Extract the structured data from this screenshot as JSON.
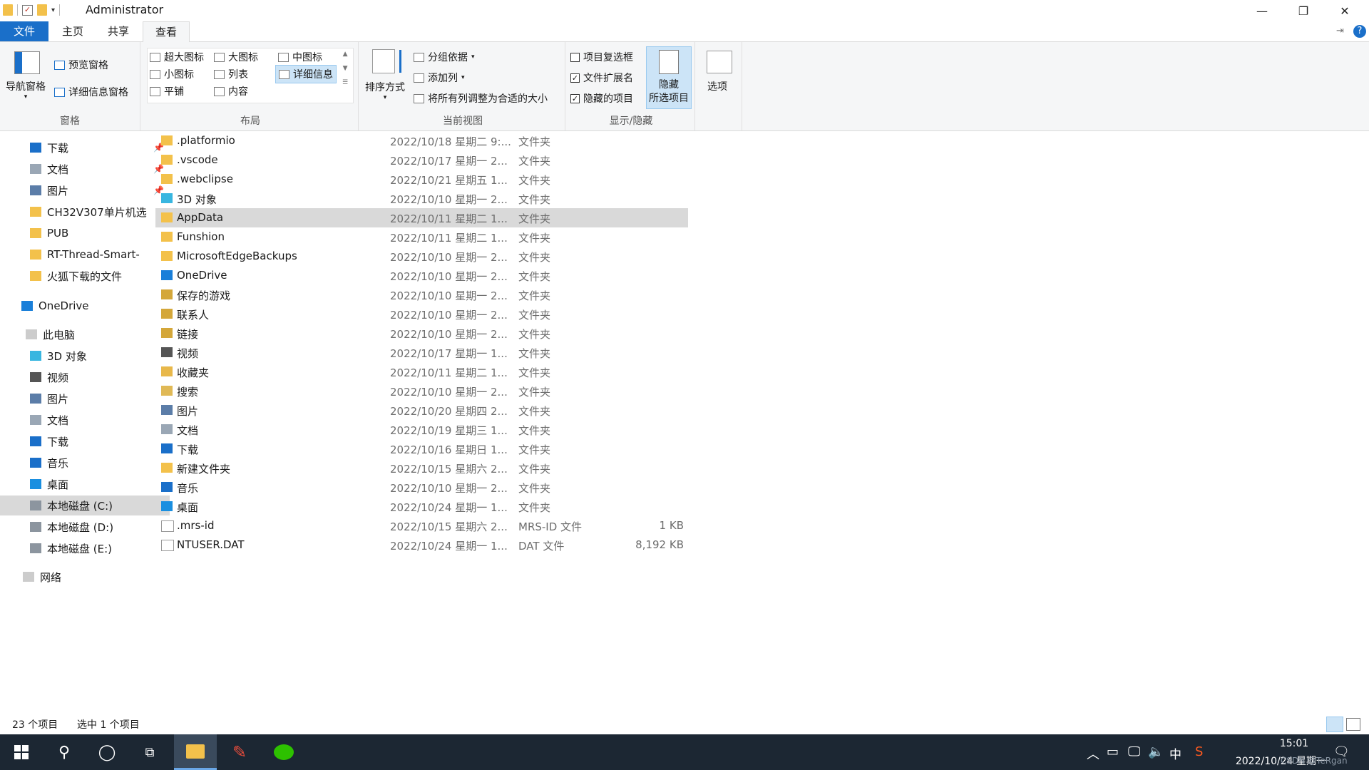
{
  "window": {
    "title": "Administrator",
    "controls": {
      "minimize": "—",
      "maximize": "❐",
      "close": "✕"
    }
  },
  "tabs": [
    {
      "label": "文件"
    },
    {
      "label": "主页"
    },
    {
      "label": "共享"
    },
    {
      "label": "查看"
    }
  ],
  "ribbon": {
    "pane_group": {
      "nav_pane": "导航窗格",
      "preview_pane": "预览窗格",
      "details_pane": "详细信息窗格",
      "label": "窗格"
    },
    "layout_group": {
      "items": [
        "超大图标",
        "大图标",
        "中图标",
        "小图标",
        "列表",
        "详细信息",
        "平铺",
        "内容"
      ],
      "selected": "详细信息",
      "label": "布局"
    },
    "current_view_group": {
      "sort": "排序方式",
      "group_by": "分组依据",
      "add_column": "添加列",
      "fit_columns": "将所有列调整为合适的大小",
      "label": "当前视图"
    },
    "show_hide_group": {
      "item_checkboxes": {
        "label": "项目复选框",
        "checked": false
      },
      "file_extensions": {
        "label": "文件扩展名",
        "checked": true
      },
      "hidden_items": {
        "label": "隐藏的项目",
        "checked": true
      },
      "hide_selected_line1": "隐藏",
      "hide_selected_line2": "所选项目",
      "label": "显示/隐藏"
    },
    "options": "选项"
  },
  "nav": {
    "quick_access": [
      {
        "label": "下载",
        "icon": "download-icon",
        "pinned": true
      },
      {
        "label": "文档",
        "icon": "document-icon",
        "pinned": true
      },
      {
        "label": "图片",
        "icon": "picture-icon",
        "pinned": true
      },
      {
        "label": "CH32V307单片机选",
        "icon": "folder-icon",
        "pinned": false
      },
      {
        "label": "PUB",
        "icon": "folder-icon",
        "pinned": false
      },
      {
        "label": "RT-Thread-Smart-",
        "icon": "folder-icon",
        "pinned": false
      },
      {
        "label": "火狐下载的文件",
        "icon": "folder-icon",
        "pinned": false
      }
    ],
    "onedrive": "OneDrive",
    "this_pc": "此电脑",
    "pc_items": [
      {
        "label": "3D 对象",
        "icon": "3d-objects-icon"
      },
      {
        "label": "视频",
        "icon": "video-icon"
      },
      {
        "label": "图片",
        "icon": "picture-icon"
      },
      {
        "label": "文档",
        "icon": "document-icon"
      },
      {
        "label": "下载",
        "icon": "download-icon"
      },
      {
        "label": "音乐",
        "icon": "music-icon"
      },
      {
        "label": "桌面",
        "icon": "desktop-icon"
      },
      {
        "label": "本地磁盘 (C:)",
        "icon": "drive-icon",
        "selected": true
      },
      {
        "label": "本地磁盘 (D:)",
        "icon": "drive-icon"
      },
      {
        "label": "本地磁盘 (E:)",
        "icon": "drive-icon"
      }
    ],
    "network": "网络"
  },
  "files": [
    {
      "name": ".platformio",
      "date": "2022/10/18 星期二 9:...",
      "type": "文件夹",
      "size": "",
      "icon": "folder-icon"
    },
    {
      "name": ".vscode",
      "date": "2022/10/17 星期一 2...",
      "type": "文件夹",
      "size": "",
      "icon": "folder-icon"
    },
    {
      "name": ".webclipse",
      "date": "2022/10/21 星期五 1...",
      "type": "文件夹",
      "size": "",
      "icon": "folder-icon"
    },
    {
      "name": "3D 对象",
      "date": "2022/10/10 星期一 2...",
      "type": "文件夹",
      "size": "",
      "icon": "3d-objects-icon"
    },
    {
      "name": "AppData",
      "date": "2022/10/11 星期二 1...",
      "type": "文件夹",
      "size": "",
      "icon": "folder-icon",
      "selected": true
    },
    {
      "name": "Funshion",
      "date": "2022/10/11 星期二 1...",
      "type": "文件夹",
      "size": "",
      "icon": "folder-icon"
    },
    {
      "name": "MicrosoftEdgeBackups",
      "date": "2022/10/10 星期一 2...",
      "type": "文件夹",
      "size": "",
      "icon": "folder-icon"
    },
    {
      "name": "OneDrive",
      "date": "2022/10/10 星期一 2...",
      "type": "文件夹",
      "size": "",
      "icon": "cloud-icon"
    },
    {
      "name": "保存的游戏",
      "date": "2022/10/10 星期一 2...",
      "type": "文件夹",
      "size": "",
      "icon": "saved-games-icon"
    },
    {
      "name": "联系人",
      "date": "2022/10/10 星期一 2...",
      "type": "文件夹",
      "size": "",
      "icon": "contacts-icon"
    },
    {
      "name": "链接",
      "date": "2022/10/10 星期一 2...",
      "type": "文件夹",
      "size": "",
      "icon": "links-icon"
    },
    {
      "name": "视频",
      "date": "2022/10/17 星期一 1...",
      "type": "文件夹",
      "size": "",
      "icon": "video-icon"
    },
    {
      "name": "收藏夹",
      "date": "2022/10/11 星期二 1...",
      "type": "文件夹",
      "size": "",
      "icon": "favorites-icon"
    },
    {
      "name": "搜索",
      "date": "2022/10/10 星期一 2...",
      "type": "文件夹",
      "size": "",
      "icon": "search-folder-icon"
    },
    {
      "name": "图片",
      "date": "2022/10/20 星期四 2...",
      "type": "文件夹",
      "size": "",
      "icon": "picture-icon"
    },
    {
      "name": "文档",
      "date": "2022/10/19 星期三 1...",
      "type": "文件夹",
      "size": "",
      "icon": "document-icon"
    },
    {
      "name": "下载",
      "date": "2022/10/16 星期日 1...",
      "type": "文件夹",
      "size": "",
      "icon": "download-icon"
    },
    {
      "name": "新建文件夹",
      "date": "2022/10/15 星期六 2...",
      "type": "文件夹",
      "size": "",
      "icon": "folder-icon"
    },
    {
      "name": "音乐",
      "date": "2022/10/10 星期一 2...",
      "type": "文件夹",
      "size": "",
      "icon": "music-icon"
    },
    {
      "name": "桌面",
      "date": "2022/10/24 星期一 1...",
      "type": "文件夹",
      "size": "",
      "icon": "desktop-icon"
    },
    {
      "name": ".mrs-id",
      "date": "2022/10/15 星期六 2...",
      "type": "MRS-ID 文件",
      "size": "1 KB",
      "icon": "file-icon"
    },
    {
      "name": "NTUSER.DAT",
      "date": "2022/10/24 星期一 1...",
      "type": "DAT 文件",
      "size": "8,192 KB",
      "icon": "file-icon"
    }
  ],
  "status": {
    "count": "23 个项目",
    "selected": "选中 1 个项目"
  },
  "taskbar": {
    "time": "15:01",
    "date": "2022/10/24 星期一",
    "ime": "中",
    "watermark": "CSDN @TeRgan"
  },
  "colors": {
    "accent": "#1a6fc9",
    "selection": "#d9d9d9",
    "taskbar": "#1c2733",
    "folder": "#f3c14b"
  }
}
